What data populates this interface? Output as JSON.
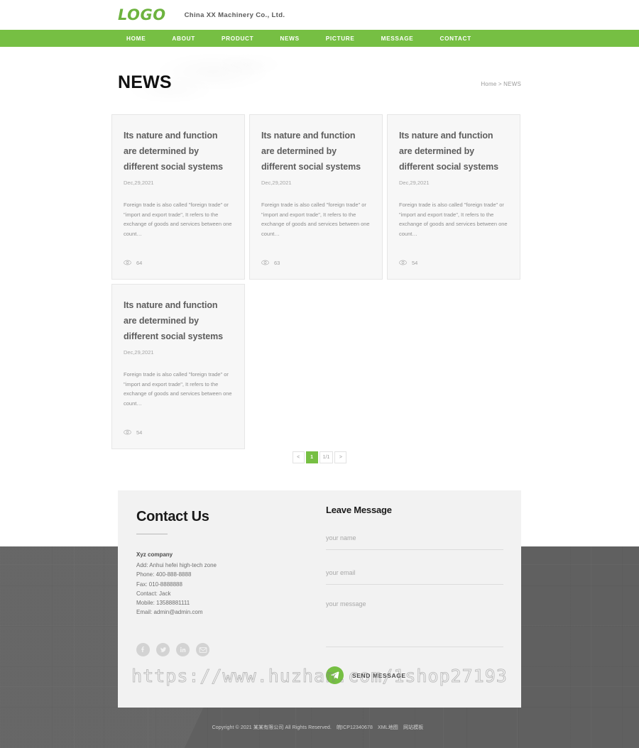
{
  "header": {
    "logo_text": "LOGO",
    "company_name": "China XX Machinery Co., Ltd."
  },
  "nav": {
    "items": [
      {
        "label": "HOME"
      },
      {
        "label": "ABOUT"
      },
      {
        "label": "PRODUCT"
      },
      {
        "label": "NEWS"
      },
      {
        "label": "PICTURE"
      },
      {
        "label": "MESSAGE"
      },
      {
        "label": "CONTACT"
      }
    ]
  },
  "hero": {
    "title": "NEWS",
    "breadcrumb": "Home > NEWS"
  },
  "news": {
    "cards": [
      {
        "title": "Its nature and function are determined by different social systems",
        "date": "Dec,29,2021",
        "excerpt": "Foreign trade is also called \"foreign trade\" or \"import and export trade\", It refers to the exchange of goods and services between one count…",
        "views": "64"
      },
      {
        "title": "Its nature and function are determined by different social systems",
        "date": "Dec,29,2021",
        "excerpt": "Foreign trade is also called \"foreign trade\" or \"import and export trade\", It refers to the exchange of goods and services between one count…",
        "views": "63"
      },
      {
        "title": "Its nature and function are determined by different social systems",
        "date": "Dec,29,2021",
        "excerpt": "Foreign trade is also called \"foreign trade\" or \"import and export trade\", It refers to the exchange of goods and services between one count…",
        "views": "54"
      },
      {
        "title": "Its nature and function are determined by different social systems",
        "date": "Dec,29,2021",
        "excerpt": "Foreign trade is also called \"foreign trade\" or \"import and export trade\", It refers to the exchange of goods and services between one count…",
        "views": "54"
      }
    ]
  },
  "pagination": {
    "prev": "<",
    "current_page": "1",
    "page_indicator": "1/1",
    "next": ">"
  },
  "contact": {
    "heading": "Contact Us",
    "company": "Xyz company",
    "lines": [
      "Add: Anhui hefei high-tech zone",
      "Phone: 400-888-8888",
      "Fax: 010-8888888",
      "Contact: Jack",
      "Mobile: 13588881111",
      "Email: admin@admin.com"
    ],
    "social": [
      {
        "name": "facebook"
      },
      {
        "name": "twitter"
      },
      {
        "name": "linkedin"
      },
      {
        "name": "email"
      }
    ]
  },
  "form": {
    "heading": "Leave Message",
    "name_placeholder": "your name",
    "email_placeholder": "your email",
    "message_placeholder": "your message",
    "name_value": "",
    "email_value": "",
    "message_value": "",
    "send_label": "SEND MESSAGE"
  },
  "watermark": {
    "text": "https://www.huzhan.com/1shop27193"
  },
  "footer": {
    "copyright": "Copyright © 2021 某某有限公司 All Rights Reserved.",
    "icp": "皖ICP12340678",
    "xml_map": "XML地图",
    "template": "网站模板"
  },
  "colors": {
    "brand_green": "#76bf43",
    "nav_green": "#76bf43",
    "panel_gray": "#f2f2f2",
    "dark_bg": "#636363"
  }
}
